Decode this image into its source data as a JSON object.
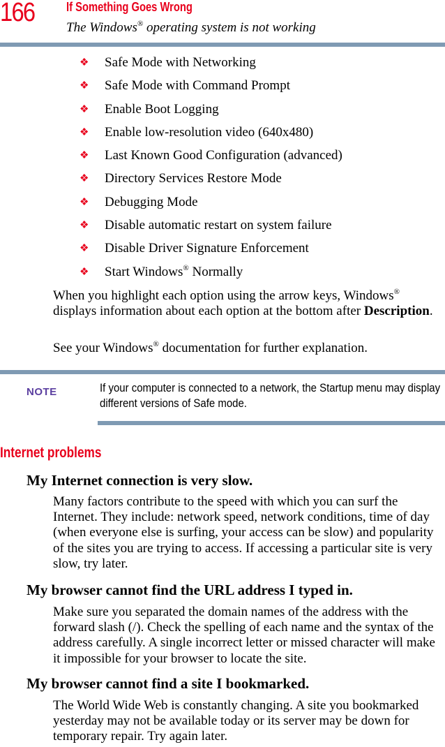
{
  "header": {
    "page_number": "166",
    "chapter": "If Something Goes Wrong",
    "section_pre": "The Windows",
    "section_reg": "®",
    "section_post": " operating system is not working"
  },
  "colors": {
    "accent_red": "#e8001c",
    "rule_blue": "#7f9ab3",
    "note_purple": "#5b3fa0"
  },
  "bullet_icon": "❖",
  "options": [
    "Safe Mode with Networking",
    "Safe Mode with Command Prompt",
    "Enable Boot Logging",
    "Enable low-resolution video (640x480)",
    "Last Known Good Configuration (advanced)",
    "Directory Services Restore Mode",
    "Debugging Mode",
    "Disable automatic restart on system failure",
    "Disable Driver Signature Enforcement"
  ],
  "last_option": {
    "pre": "Start Windows",
    "reg": "®",
    "post": " Normally"
  },
  "para1": {
    "pre": "When you highlight each option using the arrow keys, Windows",
    "reg": "®",
    "mid": " displays information about each option at the bottom after ",
    "bold": "Description",
    "post": "."
  },
  "para2": {
    "pre": "See your Windows",
    "reg": "®",
    "post": " documentation for further explanation."
  },
  "note": {
    "label": "NOTE",
    "text": "If your computer is connected to a network, the Startup menu may display different versions of Safe mode."
  },
  "internet": {
    "heading": "Internet problems",
    "items": [
      {
        "question": "My Internet connection is very slow.",
        "answer": "Many factors contribute to the speed with which you can surf the Internet. They include: network speed, network conditions, time of day (when everyone else is surfing, your access can be slow) and popularity of the sites you are trying to access. If accessing a particular site is very slow, try later."
      },
      {
        "question": "My browser cannot find the URL address I typed in.",
        "answer": "Make sure you separated the domain names of the address with the forward slash (/). Check the spelling of each name and the syntax of the address carefully. A single incorrect letter or missed character will make it impossible for your browser to locate the site."
      },
      {
        "question": "My browser cannot find a site I bookmarked.",
        "answer": "The World Wide Web is constantly changing. A site you bookmarked yesterday may not be available today or its server may be down for temporary repair. Try again later."
      }
    ]
  }
}
